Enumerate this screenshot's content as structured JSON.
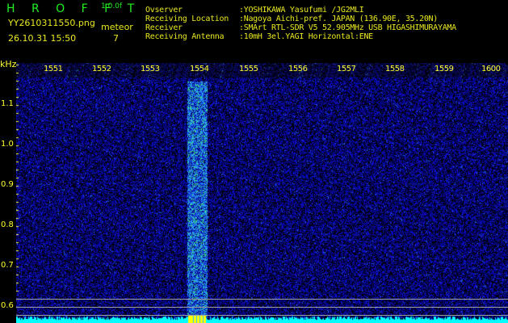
{
  "app": {
    "title": "H R O F F T",
    "version": "1.0.0f",
    "filename": "YY2610311550.png",
    "datetime": "26.10.31 15:50",
    "meteor_label": "meteor",
    "meteor_count": "7"
  },
  "info": [
    {
      "label": "Ovserver",
      "value": ":YOSHIKAWA Yasufumi /JG2MLI"
    },
    {
      "label": "Receiving Location",
      "value": ":Nagoya Aichi-pref. JAPAN (136.90E, 35.20N)"
    },
    {
      "label": "Receiver",
      "value": ":SMArt RTL-SDR V5 52.905MHz USB HIGASHIMURAYAMA"
    },
    {
      "label": "Receiving Antenna",
      "value": ":10mH 3el.YAGI Horizontal:ENE"
    }
  ],
  "axis": {
    "y_unit": "kHz",
    "y_labels": [
      "1.1",
      "1.0",
      "0.9",
      "0.8",
      "0.7",
      "0.6"
    ],
    "x_labels": [
      "1551",
      "1552",
      "1553",
      "1554",
      "1555",
      "1556",
      "1557",
      "1558",
      "1559",
      "1600"
    ]
  },
  "colors": {
    "background": "#000000",
    "noise": "#1020c0",
    "meteor": "#30c0ff",
    "baseline": "#00ffff",
    "marker": "#ffff00"
  }
}
